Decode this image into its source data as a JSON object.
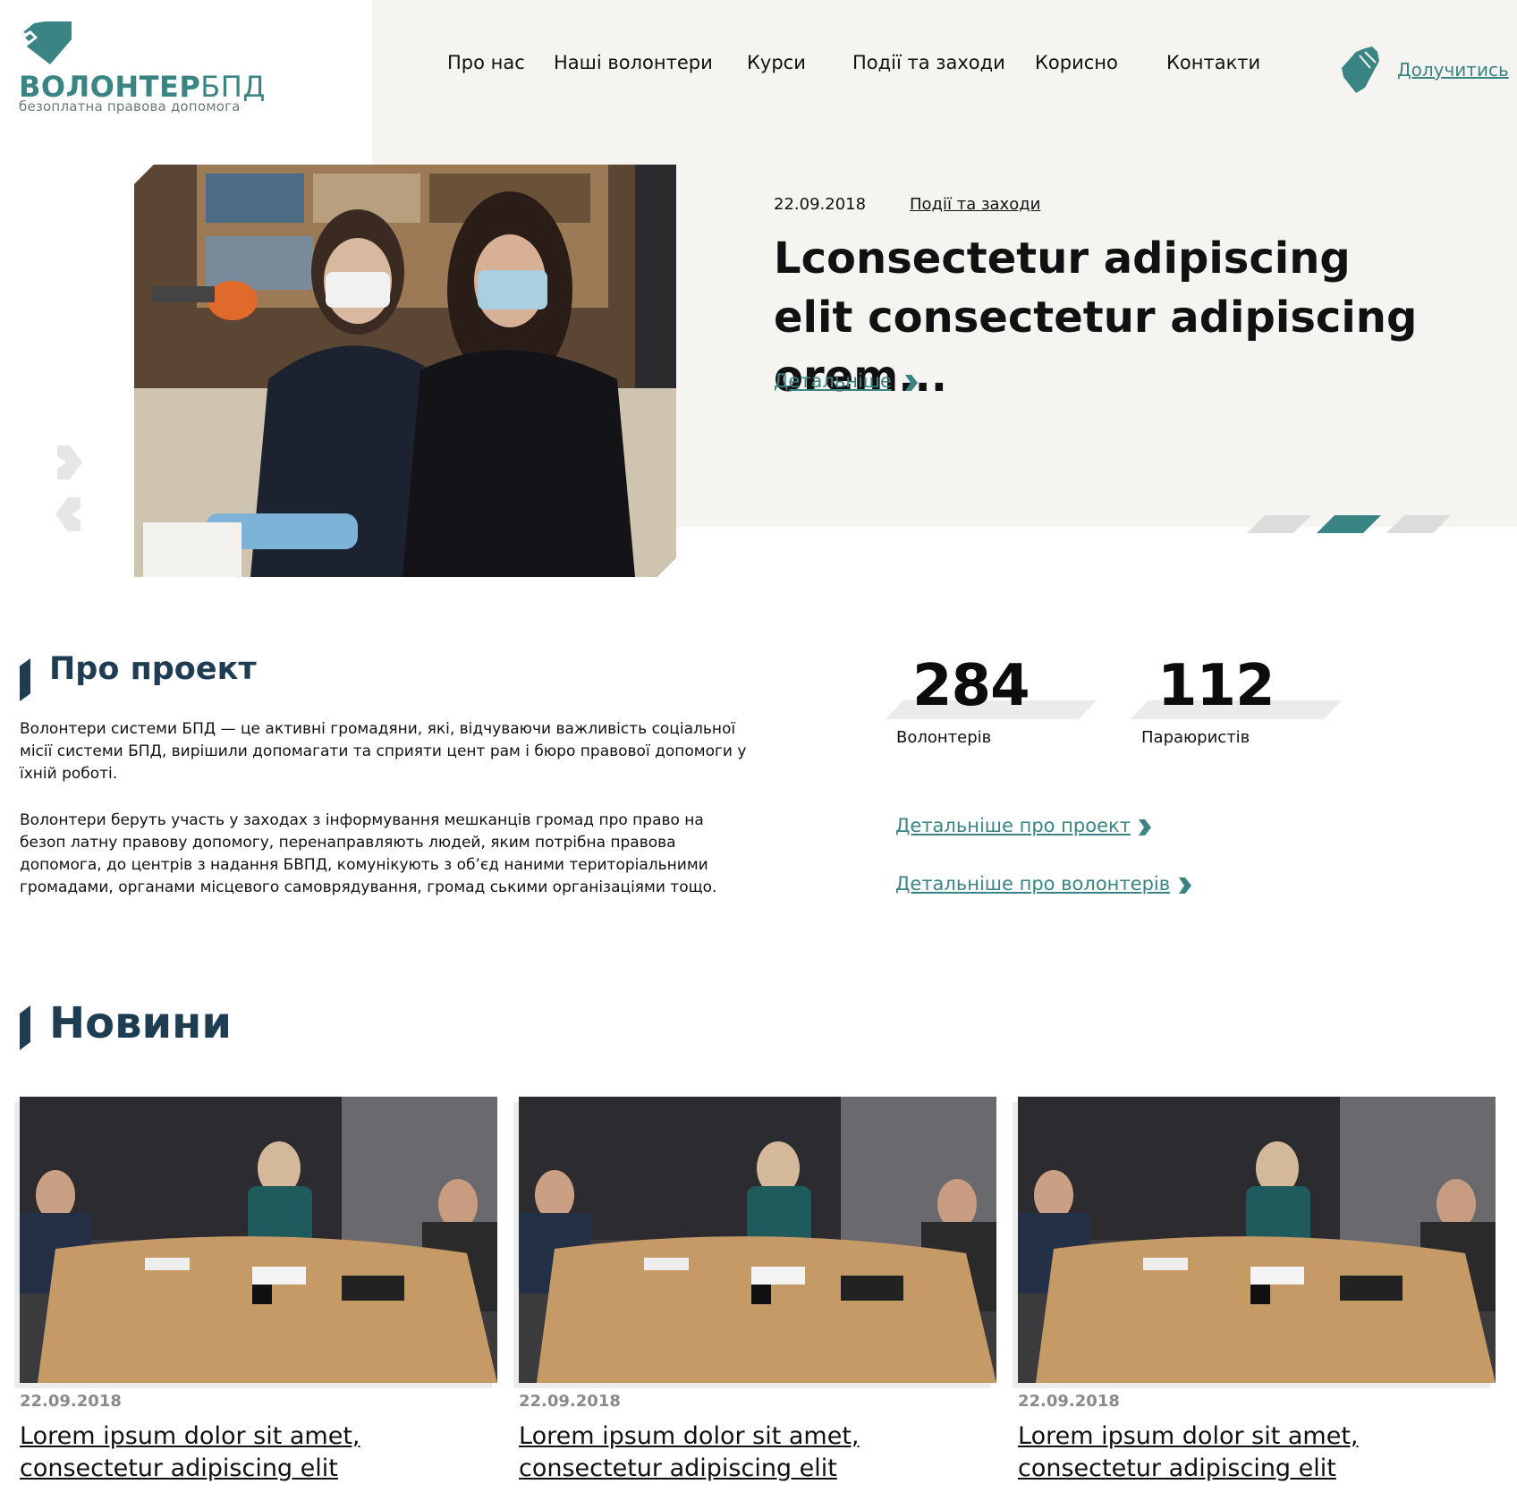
{
  "brand": {
    "name_bold": "ВОЛОНТЕР",
    "name_thin": "БПД",
    "tagline": "безоплатна правова допомога",
    "accent_color": "#3a8584",
    "heading_color": "#1f3d52"
  },
  "nav": {
    "items": [
      {
        "label": "Про нас"
      },
      {
        "label": "Наші волонтери"
      },
      {
        "label": "Курси"
      },
      {
        "label": "Події та заходи"
      },
      {
        "label": "Корисно"
      },
      {
        "label": "Контакти"
      }
    ],
    "join_label": "Долучитись",
    "join_icon": "raised-hand-icon"
  },
  "hero": {
    "date": "22.09.2018",
    "category": "Події та заходи",
    "title": "Lconsectetur adipiscing elit consectetur adipiscing orem...",
    "more_label": "Детальніше",
    "slides_total": 3,
    "active_slide": 2
  },
  "about": {
    "title": "Про проект",
    "paragraph_1": "Волонтери системи БПД — це активні громадяни, які, відчуваючи важливість соціальної місії системи БПД, вирішили допомагати та сприяти цент рам і бюро правової допомоги у їхній роботі.",
    "paragraph_2": "Волонтери беруть участь у заходах з інформування мешканців громад про право на безоп латну правову допомогу, перенаправляють людей, яким потрібна правова допомога, до центрів з надання БВПД, комунікують з об’єд наними територіальними громадами, органами місцевого самоврядування, громад ськими організаціями тощо.",
    "stats": [
      {
        "value": "284",
        "label": "Волонтерів"
      },
      {
        "value": "112",
        "label": "Параюристів"
      }
    ],
    "link_project": "Детальніше про проект",
    "link_volunteers": "Детальніше про волонтерів"
  },
  "news": {
    "title": "Новини",
    "items": [
      {
        "date": "22.09.2018",
        "title": "Lorem ipsum dolor sit amet, consectetur adipiscing elit"
      },
      {
        "date": "22.09.2018",
        "title": "Lorem ipsum dolor sit amet, consectetur adipiscing elit"
      },
      {
        "date": "22.09.2018",
        "title": "Lorem ipsum dolor sit amet, consectetur adipiscing elit"
      }
    ]
  }
}
